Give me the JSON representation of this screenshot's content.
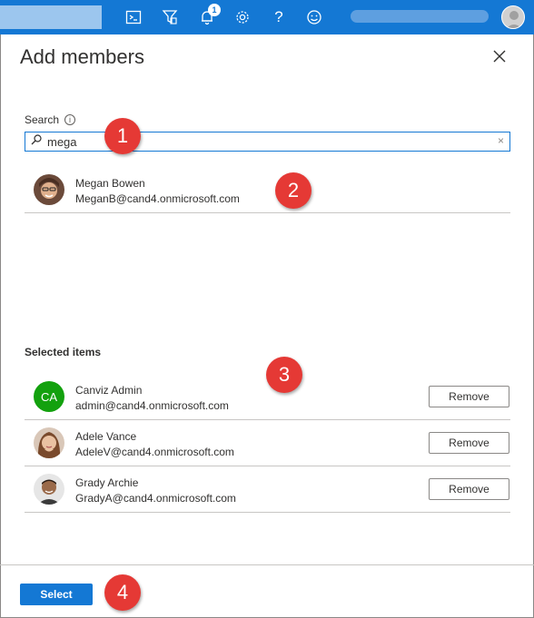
{
  "topbar": {
    "notification_count": "1",
    "icons": [
      "cloud-shell-icon",
      "directory-filter-icon",
      "notifications-icon",
      "settings-icon",
      "help-icon",
      "feedback-icon"
    ]
  },
  "panel": {
    "title": "Add members",
    "search": {
      "label": "Search",
      "info": "i",
      "value": "mega",
      "clear": "×"
    },
    "result": {
      "name": "Megan Bowen",
      "email": "MeganB@cand4.onmicrosoft.com"
    },
    "selected_heading": "Selected items",
    "selected_items": [
      {
        "initials": "CA",
        "name": "Canviz Admin",
        "email": "admin@cand4.onmicrosoft.com",
        "remove_label": "Remove"
      },
      {
        "initials": "",
        "name": "Adele Vance",
        "email": "AdeleV@cand4.onmicrosoft.com",
        "remove_label": "Remove"
      },
      {
        "initials": "",
        "name": "Grady Archie",
        "email": "GradyA@cand4.onmicrosoft.com",
        "remove_label": "Remove"
      }
    ],
    "select_label": "Select"
  },
  "callouts": [
    "1",
    "2",
    "3",
    "4"
  ],
  "colors": {
    "brand": "#1478d4",
    "callout": "#e53935",
    "initials_avatar": "#13a10e"
  }
}
